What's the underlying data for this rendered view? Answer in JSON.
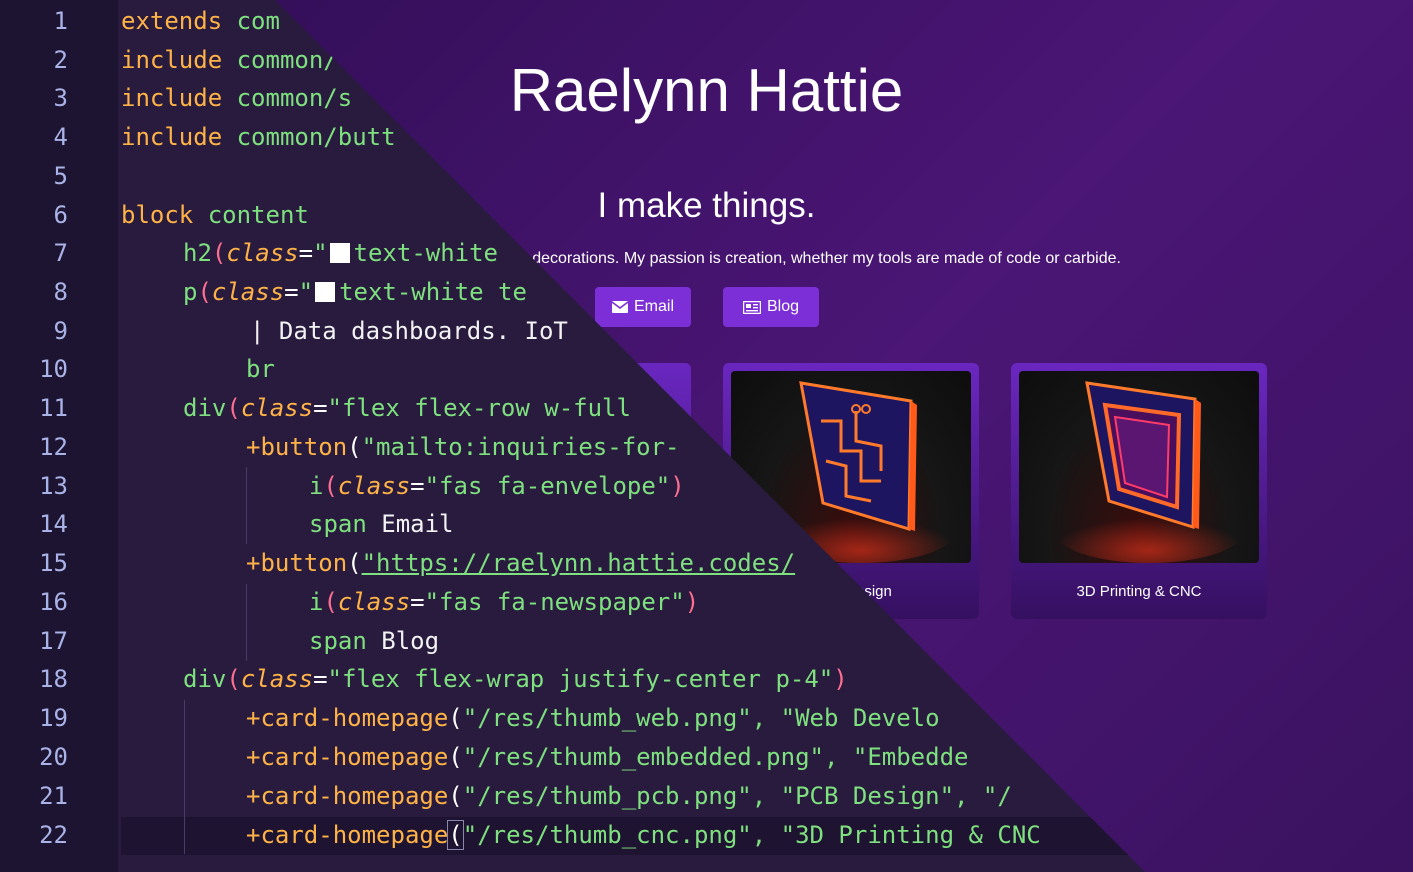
{
  "site": {
    "name": "Raelynn Hattie",
    "tagline": "I make things.",
    "blurb": "Data dashboards. IoT. Halloween decorations. My passion is creation, whether my tools are made of code or carbide.",
    "buttons": [
      {
        "label": "Email",
        "icon": "envelope-icon"
      },
      {
        "label": "Blog",
        "icon": "newspaper-icon"
      }
    ],
    "cards": [
      {
        "caption": "PCB Design",
        "icon": "pcb-thumbnail"
      },
      {
        "caption": "3D Printing & CNC",
        "icon": "chip-thumbnail"
      }
    ],
    "accent": "#7c2fd6"
  },
  "editor": {
    "line_numbers": [
      "1",
      "2",
      "3",
      "4",
      "5",
      "6",
      "7",
      "8",
      "9",
      "10",
      "11",
      "12",
      "13",
      "14",
      "15",
      "16",
      "17",
      "18",
      "19",
      "20",
      "21",
      "22"
    ],
    "lines": {
      "l1": [
        "extends",
        " com"
      ],
      "l2": [
        "include",
        " common/"
      ],
      "l3": [
        "include",
        " common/s"
      ],
      "l4": [
        "include",
        " common/butt"
      ],
      "l6": [
        "block",
        " content"
      ],
      "l7": [
        "h2",
        "(",
        "class",
        "=",
        "\"",
        "text-white"
      ],
      "l8": [
        "p",
        "(",
        "class",
        "=",
        "\"",
        "text-white te"
      ],
      "l9": [
        "| Data dashboards. IoT"
      ],
      "l10": [
        "br"
      ],
      "l11": [
        "div",
        "(",
        "class",
        "=",
        "\"flex flex-row w-full"
      ],
      "l12": [
        "+button",
        "(",
        "\"mailto:inquiries-for-"
      ],
      "l13": [
        "i",
        "(",
        "class",
        "=",
        "\"fas fa-envelope\"",
        ")"
      ],
      "l14": [
        "span",
        " Email"
      ],
      "l15": [
        "+button",
        "(",
        "\"https://raelynn.hattie.codes/"
      ],
      "l16": [
        "i",
        "(",
        "class",
        "=",
        "\"fas fa-newspaper\"",
        ")"
      ],
      "l17": [
        "span",
        " Blog"
      ],
      "l18": [
        "div",
        "(",
        "class",
        "=",
        "\"flex flex-wrap justify-center p-4\"",
        ")"
      ],
      "l19": [
        "+card-homepage",
        "(",
        "\"/res/thumb_web.png\", \"Web Develo"
      ],
      "l20": [
        "+card-homepage",
        "(",
        "\"/res/thumb_embedded.png\", \"Embedde"
      ],
      "l21": [
        "+card-homepage",
        "(",
        "\"/res/thumb_pcb.png\", \"PCB Design\", \"/"
      ],
      "l22": [
        "+card-homepage",
        "(",
        "\"/res/thumb_cnc.png\", \"3D Printing & CNC"
      ]
    }
  }
}
